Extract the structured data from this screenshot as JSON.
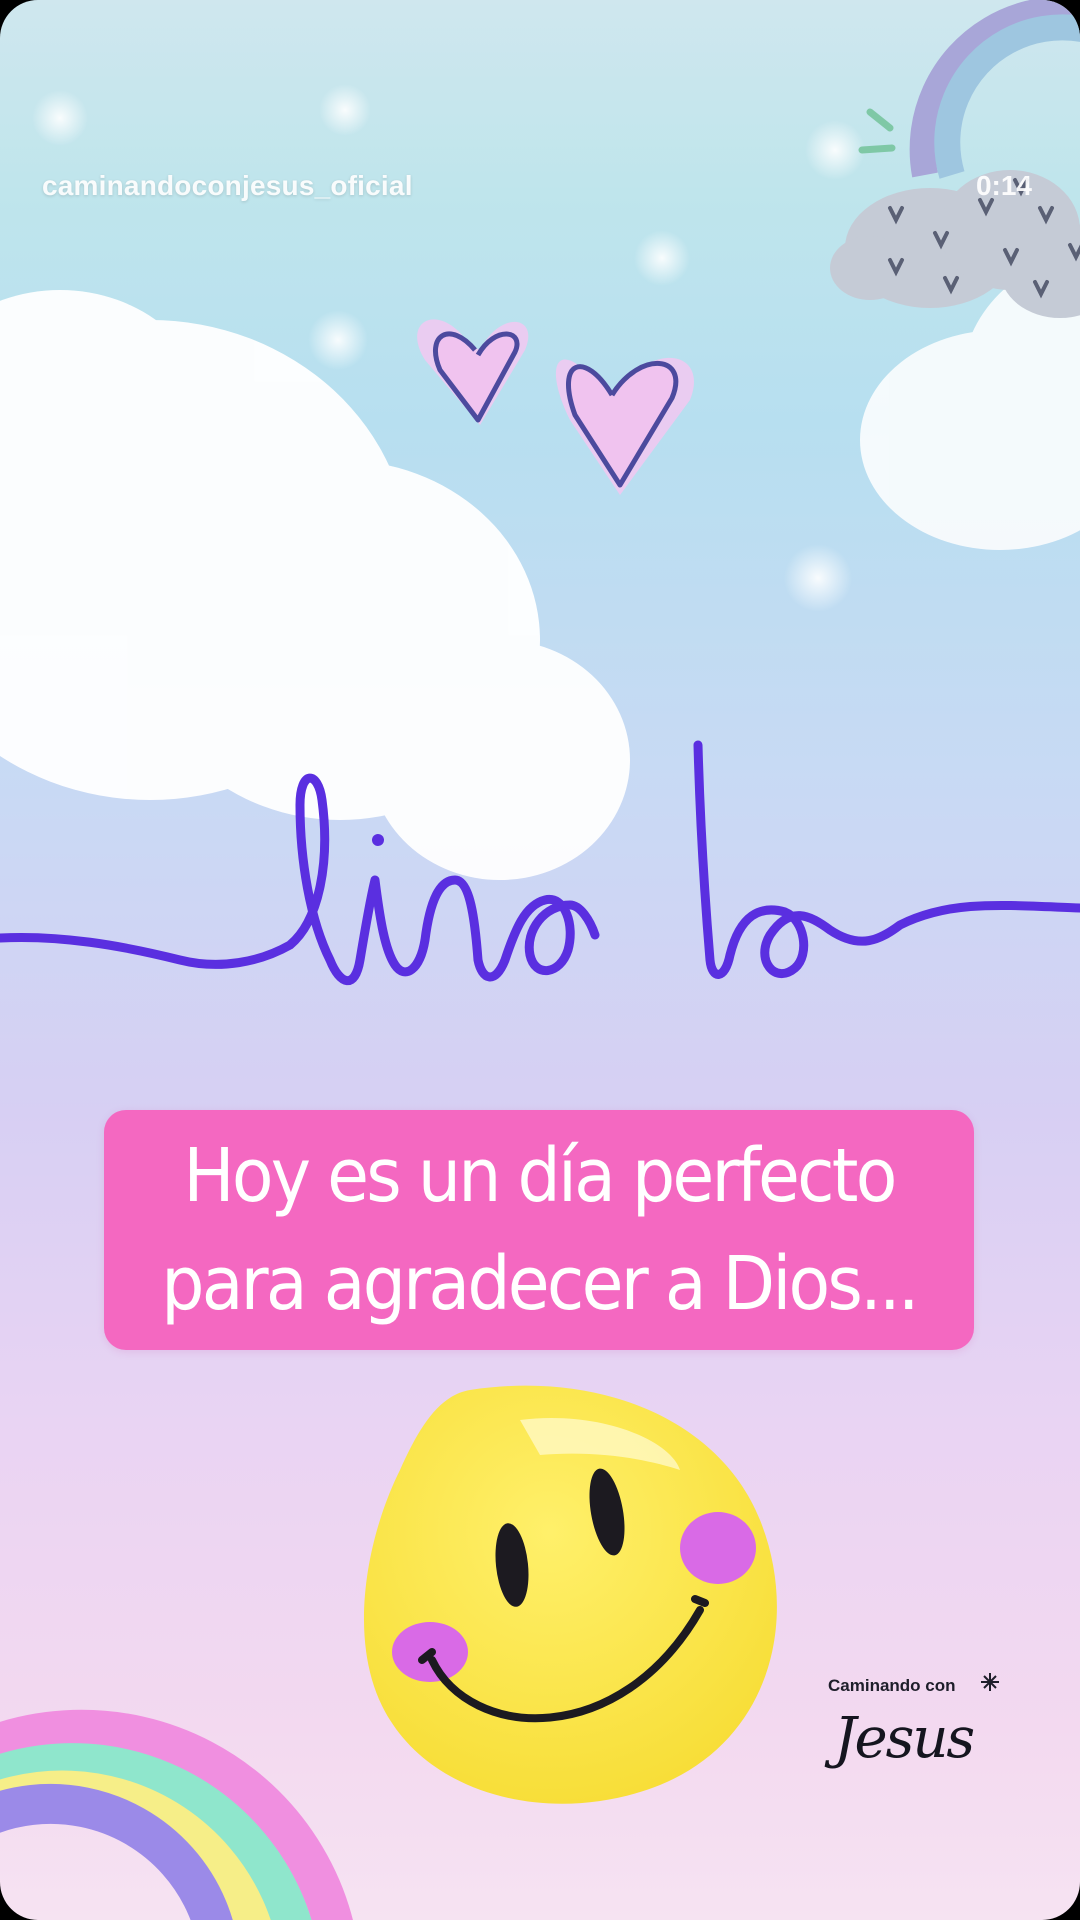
{
  "story": {
    "username": "caminandoconjesus_oficial",
    "time": "0:14"
  },
  "artwork": {
    "title_word": "lindo",
    "caption_lines": [
      "Hoy es un día perfecto",
      "para agradecer a Dios..."
    ],
    "brand_top": "Caminando con",
    "brand_script": "Jesus"
  },
  "colors": {
    "caption_bg": "#f468c1",
    "script_stroke": "#5a2fe0",
    "smiley": "#fbe340"
  },
  "icons": [
    "heart-icon",
    "rainbow-icon",
    "cloud-icon",
    "smiley-icon",
    "sparkle-icon"
  ]
}
